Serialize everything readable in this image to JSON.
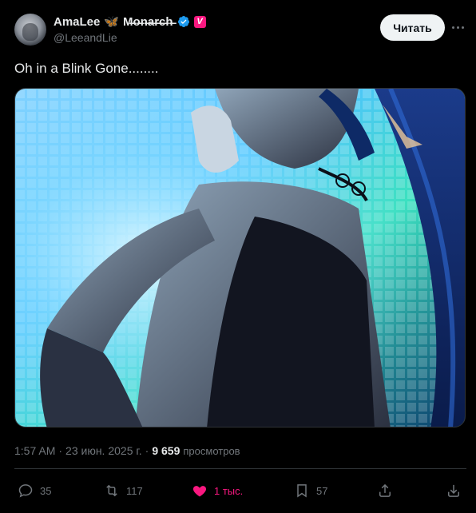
{
  "author": {
    "display_name": "AmaLee",
    "name_suffix": "M̶o̶n̶a̶r̶c̶h̶",
    "emoji": "🦋",
    "handle": "@LeeandLie",
    "badge_letter": "V"
  },
  "follow_label": "Читать",
  "tweet_text": "Oh in a Blink Gone........",
  "meta": {
    "time": "1:57 AM",
    "separator": "·",
    "date": "23 июн. 2025 г.",
    "views_count": "9 659",
    "views_label": "просмотров"
  },
  "actions": {
    "replies": "35",
    "reposts": "117",
    "likes": "1 тыс.",
    "bookmarks": "57"
  },
  "colors": {
    "like": "#f91880",
    "verified": "#1d9bf0",
    "muted": "#71767b"
  }
}
